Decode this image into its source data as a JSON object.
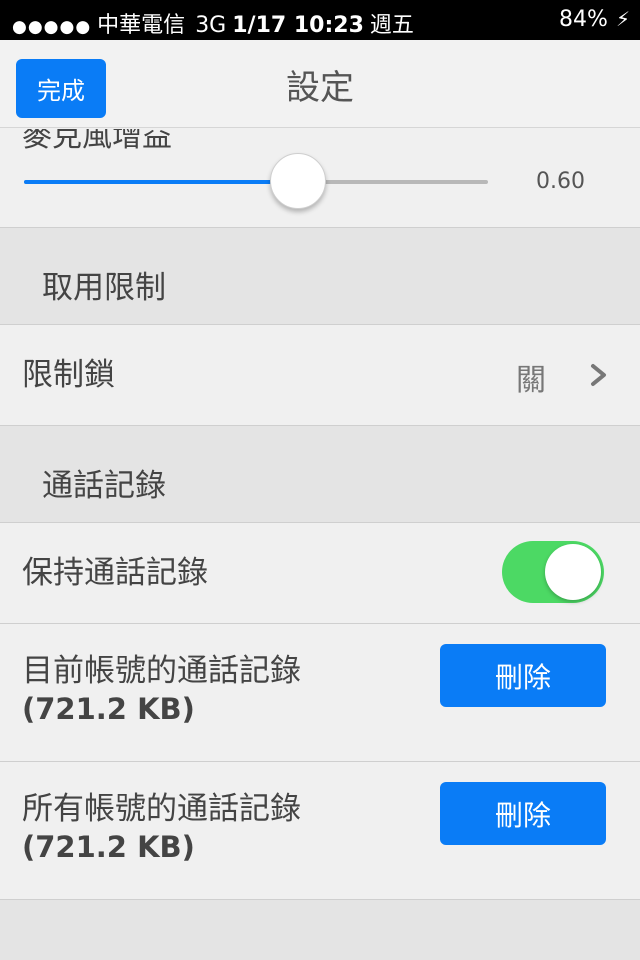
{
  "status_bar": {
    "signal": "●●●●●",
    "carrier": "中華電信",
    "network": "3G",
    "datetime": "1/17 10:23",
    "weekday": "週五",
    "battery": "84%"
  },
  "nav": {
    "done_label": "完成",
    "title": "設定"
  },
  "mic_gain": {
    "label": "麥克風增益",
    "value_text": "0.60",
    "fill_fraction": 0.59
  },
  "restrictions": {
    "header": "取用限制",
    "lock_label": "限制鎖",
    "lock_value": "關"
  },
  "call_log": {
    "header": "通話記錄",
    "keep_label": "保持通話記錄",
    "keep_enabled": true,
    "current_account_label": "目前帳號的通話記錄",
    "current_account_size": "(721.2 KB)",
    "current_account_delete": "刪除",
    "all_accounts_label": "所有帳號的通話記錄",
    "all_accounts_size": "(721.2 KB)",
    "all_accounts_delete": "刪除"
  },
  "colors": {
    "accent": "#0a7cf6",
    "toggle_on": "#4cd964",
    "status_bar": "#000000"
  }
}
